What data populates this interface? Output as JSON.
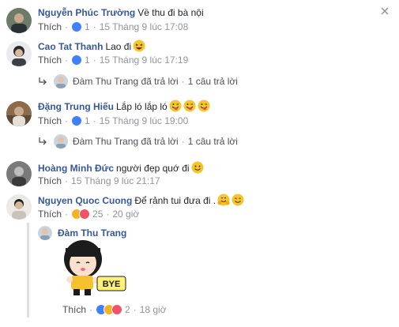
{
  "comments": [
    {
      "author": "Nguyễn Phúc Trường",
      "text": "Về thu đi bà nội",
      "like_label": "Thích",
      "like_count": "1",
      "time": "15 Tháng 9 lúc 17:08"
    },
    {
      "author": "Cao Tat Thanh",
      "text": "Lao đi",
      "like_label": "Thích",
      "like_count": "1",
      "time": "15 Tháng 9 lúc 17:19"
    },
    {
      "author": "Đặng Trung Hiếu",
      "text": "Lắp ló lắp ló",
      "like_label": "Thích",
      "like_count": "1",
      "time": "15 Tháng 9 lúc 19:00"
    },
    {
      "author": "Hoàng Minh Đức",
      "text": "người đẹp quớ đi",
      "like_label": "Thích",
      "time": "15 Tháng 9 lúc 21:17"
    },
    {
      "author": "Nguyen Quoc Cuong",
      "text": "Để rảnh tui đưa đi .",
      "like_label": "Thích",
      "like_count": "25",
      "time": "20 giờ"
    }
  ],
  "replies": [
    {
      "name": "Đàm Thu Trang",
      "action": "đã trả lời",
      "count": "1 câu trả lời"
    },
    {
      "name": "Đàm Thu Trang",
      "action": "đã trả lời",
      "count": "1 câu trả lời"
    }
  ],
  "nested_reply": {
    "author": "Đàm Thu Trang",
    "like_label": "Thích",
    "like_count": "2",
    "time": "18 giờ",
    "sticker_text": "BYE"
  },
  "colors": {
    "author": "#365899",
    "meta": "#90949c",
    "like_blue": "#4080ff",
    "haha_yellow": "#f7b125",
    "love_red": "#f25268"
  }
}
